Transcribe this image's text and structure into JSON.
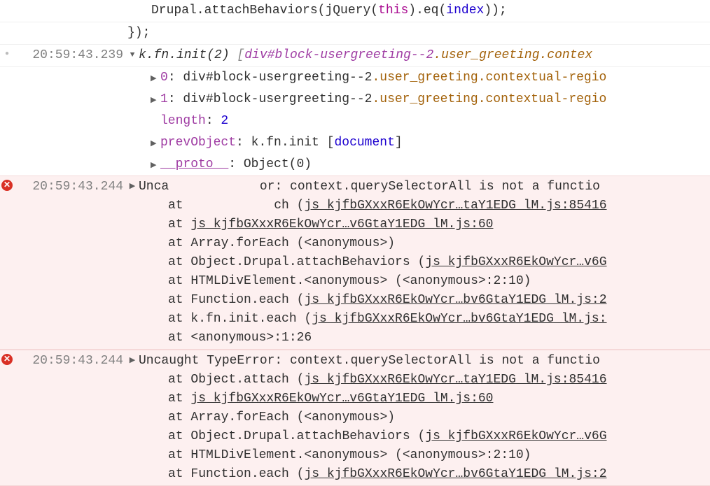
{
  "code_snippet": {
    "line1_p1": "Drupal.attachBehaviors(jQuery(",
    "line1_this": "this",
    "line1_p2": ").eq(",
    "line1_idx": "index",
    "line1_p3": "));",
    "line2": "});"
  },
  "log1": {
    "ts": "20:59:43.239",
    "header_p1": "k.fn.init(2)",
    "header_p2": " [",
    "header_el": "div#block-usergreeting--2",
    "header_cls": ".user_greeting.contex",
    "prop0": {
      "k": "0",
      "el": "div#block-usergreeting--2",
      "cls": ".user_greeting.contextual-regio"
    },
    "prop1": {
      "k": "1",
      "el": "div#block-usergreeting--2",
      "cls": ".user_greeting.contextual-regio"
    },
    "length": {
      "k": "length",
      "v": "2"
    },
    "prev": {
      "k": "prevObject",
      "v1": "k.fn.init [",
      "doc": "document",
      "v2": "]"
    },
    "proto": {
      "k": "__proto__",
      "v": "Object(0)"
    }
  },
  "tooltip": "__proto__",
  "err1": {
    "ts": "20:59:43.244",
    "msg_p1": "Unca",
    "msg_p2": "or: context.querySelectorAll is not a functio",
    "stack": [
      {
        "pre": "at ",
        "mid": "ch (",
        "link": "js_kjfbGXxxR6EkOwYcr…taY1EDG_lM.js:85416",
        "gap": true
      },
      {
        "pre": "at ",
        "link": "js_kjfbGXxxR6EkOwYcr…v6GtaY1EDG_lM.js:60"
      },
      {
        "pre": "at Array.forEach (<anonymous>)"
      },
      {
        "pre": "at Object.Drupal.attachBehaviors (",
        "link": "js_kjfbGXxxR6EkOwYcr…v6G"
      },
      {
        "pre": "at HTMLDivElement.<anonymous> (<anonymous>:2:10)"
      },
      {
        "pre": "at Function.each (",
        "link": "js_kjfbGXxxR6EkOwYcr…bv6GtaY1EDG_lM.js:2"
      },
      {
        "pre": "at k.fn.init.each (",
        "link": "js_kjfbGXxxR6EkOwYcr…bv6GtaY1EDG_lM.js:"
      },
      {
        "pre": "at <anonymous>:1:26"
      }
    ]
  },
  "err2": {
    "ts": "20:59:43.244",
    "msg": "Uncaught TypeError: context.querySelectorAll is not a functio",
    "stack": [
      {
        "pre": "at Object.attach (",
        "link": "js_kjfbGXxxR6EkOwYcr…taY1EDG_lM.js:85416"
      },
      {
        "pre": "at ",
        "link": "js_kjfbGXxxR6EkOwYcr…v6GtaY1EDG_lM.js:60"
      },
      {
        "pre": "at Array.forEach (<anonymous>)"
      },
      {
        "pre": "at Object.Drupal.attachBehaviors (",
        "link": "js_kjfbGXxxR6EkOwYcr…v6G"
      },
      {
        "pre": "at HTMLDivElement.<anonymous> (<anonymous>:2:10)"
      },
      {
        "pre": "at Function.each (",
        "link": "js_kjfbGXxxR6EkOwYcr…bv6GtaY1EDG_lM.js:2"
      }
    ]
  }
}
